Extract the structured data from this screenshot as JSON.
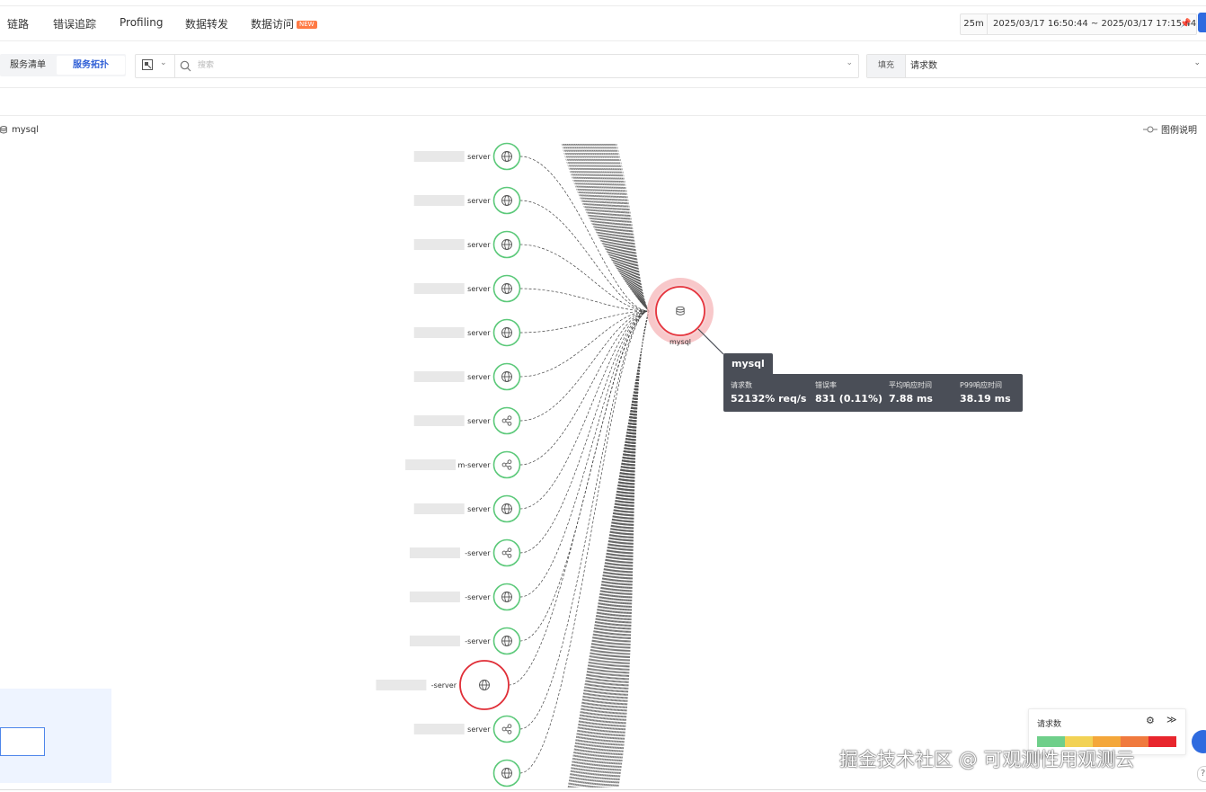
{
  "nav": {
    "items": [
      "链路",
      "错误追踪",
      "Profiling",
      "数据转发",
      "数据访问"
    ],
    "new_badge": "NEW"
  },
  "time": {
    "quick": "25m",
    "range": "2025/03/17 16:50:44 ~ 2025/03/17 17:15:44"
  },
  "view_switch": {
    "list": "服务清单",
    "topology": "服务拓扑"
  },
  "search": {
    "placeholder": "搜索"
  },
  "fill": {
    "label": "填充",
    "value": "请求数"
  },
  "breadcrumb": {
    "current": "mysql"
  },
  "legend_link": "图例说明",
  "graph": {
    "center": {
      "name": "mysql",
      "status_color": "#e5343d"
    },
    "nodes": [
      {
        "label": "server",
        "icon": "globe-icon",
        "status": "ok"
      },
      {
        "label": "server",
        "icon": "globe-icon",
        "status": "ok"
      },
      {
        "label": "server",
        "icon": "globe-icon",
        "status": "ok"
      },
      {
        "label": "server",
        "icon": "globe-icon",
        "status": "ok"
      },
      {
        "label": "server",
        "icon": "globe-icon",
        "status": "ok"
      },
      {
        "label": "server",
        "icon": "globe-icon",
        "status": "ok"
      },
      {
        "label": "server",
        "icon": "share-icon",
        "status": "ok"
      },
      {
        "label": "m-server",
        "icon": "share-icon",
        "status": "ok"
      },
      {
        "label": "server",
        "icon": "globe-icon",
        "status": "ok"
      },
      {
        "label": "-server",
        "icon": "share-icon",
        "status": "ok"
      },
      {
        "label": "-server",
        "icon": "globe-icon",
        "status": "ok"
      },
      {
        "label": "-server",
        "icon": "globe-icon",
        "status": "ok"
      },
      {
        "label": "-server",
        "icon": "globe-icon",
        "status": "error"
      },
      {
        "label": "server",
        "icon": "share-icon",
        "status": "ok"
      },
      {
        "label": "",
        "icon": "globe-icon",
        "status": "ok"
      }
    ]
  },
  "tooltip": {
    "title": "mysql",
    "metrics": [
      {
        "label": "请求数",
        "value": "52132% req/s"
      },
      {
        "label": "错误率",
        "value": "831 (0.11%)"
      },
      {
        "label": "平均响应时间",
        "value": "7.88 ms"
      },
      {
        "label": "P99响应时间",
        "value": "38.19 ms"
      }
    ]
  },
  "legend": {
    "title": "请求数",
    "colors": [
      "#6fcf8a",
      "#f2d255",
      "#f4a73a",
      "#f07a3e",
      "#e8262d"
    ]
  },
  "watermark": "掘金技术社区 @ 可观测性用观测云",
  "colors": {
    "ok": "#5cc97a",
    "error": "#e02d36",
    "accent": "#2f5fd6"
  }
}
